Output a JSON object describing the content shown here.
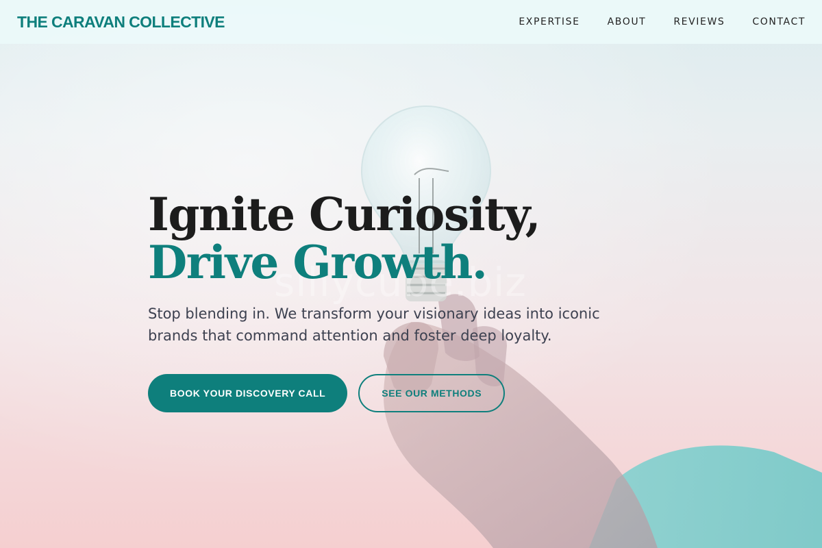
{
  "header": {
    "brand": "THE CARAVAN COLLECTIVE",
    "nav": [
      {
        "label": "EXPERTISE"
      },
      {
        "label": "ABOUT"
      },
      {
        "label": "REVIEWS"
      },
      {
        "label": "CONTACT"
      }
    ]
  },
  "hero": {
    "headline_line1": "Ignite Curiosity,",
    "headline_line2": "Drive Growth.",
    "subtext": "Stop blending in. We transform your visionary ideas into iconic brands that command attention and foster deep loyalty.",
    "primary_cta": "BOOK YOUR DISCOVERY CALL",
    "secondary_cta": "SEE OUR METHODS",
    "watermark": "sillycube.biz"
  },
  "colors": {
    "accent": "#0e7f7c",
    "heading": "#1c1c1c",
    "body_text": "#3d4150",
    "nav_bg": "#ecfafa"
  }
}
